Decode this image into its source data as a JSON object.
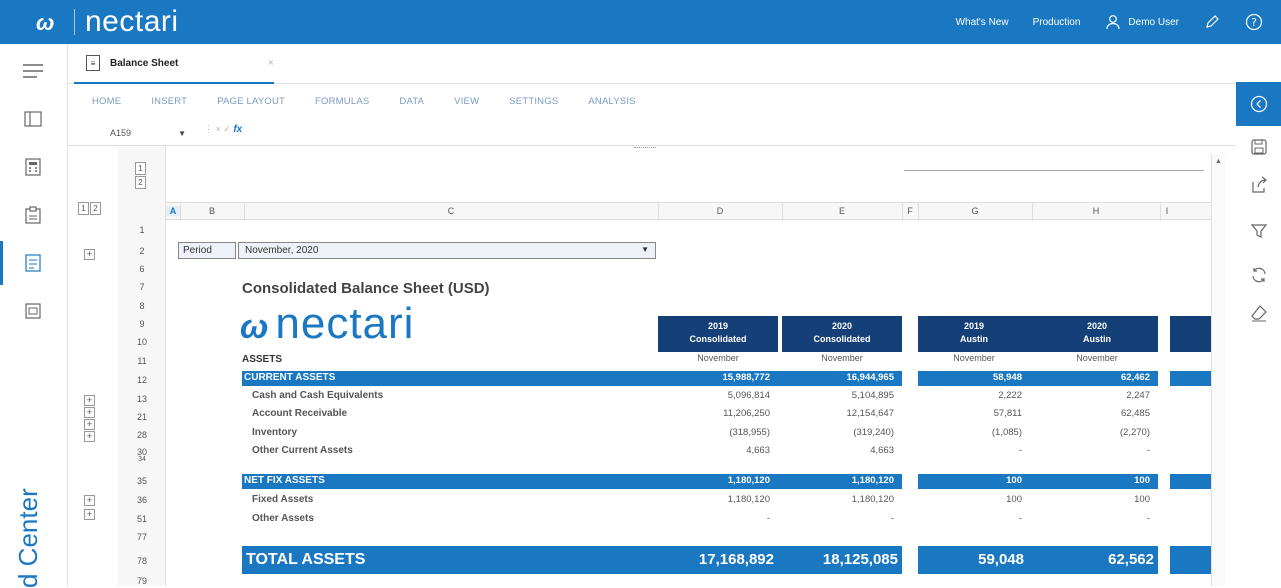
{
  "header": {
    "brand_mark": "ω",
    "brand_name": "nectari",
    "whats_new": "What's New",
    "environment": "Production",
    "user": "Demo User",
    "user_icon": "user-icon",
    "edit_icon": "pencil-icon",
    "help_icon": "help-icon",
    "bg_color": "#1a78c2"
  },
  "left_rail": {
    "items": [
      "panel-icon",
      "calculator-icon",
      "clipboard-icon",
      "document-icon",
      "folder-icon"
    ],
    "vertical_label": "d Center"
  },
  "right_rail": {
    "items": [
      "collapse-icon",
      "save-icon",
      "share-icon",
      "filter-icon",
      "refresh-icon",
      "eraser-icon"
    ]
  },
  "tab": {
    "title": "Balance Sheet",
    "close": "×"
  },
  "ribbon": {
    "items": [
      "HOME",
      "INSERT",
      "PAGE LAYOUT",
      "FORMULAS",
      "DATA",
      "VIEW",
      "SETTINGS",
      "ANALYSIS"
    ]
  },
  "formula_bar": {
    "cell_ref": "A159",
    "fx": "fx",
    "separators": "⋮  ×  ✓"
  },
  "outline": {
    "levels_top": [
      "1",
      "2"
    ],
    "levels_left": [
      "1",
      "2"
    ],
    "plus": "+"
  },
  "columns": [
    "A",
    "B",
    "C",
    "D",
    "E",
    "F",
    "G",
    "H",
    "I"
  ],
  "rows": [
    "1",
    "2",
    "6",
    "7",
    "8",
    "9",
    "10",
    "11",
    "12",
    "13",
    "21",
    "28",
    "30",
    "34",
    "35",
    "36",
    "51",
    "77",
    "78",
    "79"
  ],
  "sheet": {
    "period_label": "Period",
    "period_value": "November, 2020",
    "title": "Consolidated Balance Sheet (USD)",
    "logo_mark": "ω",
    "logo_text": "nectari",
    "assets_label": "ASSETS",
    "col_heads": [
      {
        "year": "2019",
        "entity": "Consolidated",
        "month": "November"
      },
      {
        "year": "2020",
        "entity": "Consolidated",
        "month": "November"
      },
      {
        "year": "2019",
        "entity": "Austin",
        "month": "November"
      },
      {
        "year": "2020",
        "entity": "Austin",
        "month": "November"
      }
    ],
    "current_assets": {
      "label": "CURRENT ASSETS",
      "values": [
        "15,988,772",
        "16,944,965",
        "58,948",
        "62,462"
      ]
    },
    "current_rows": [
      {
        "label": "Cash and Cash Equivalents",
        "values": [
          "5,096,814",
          "5,104,895",
          "2,222",
          "2,247"
        ]
      },
      {
        "label": "Account Receivable",
        "values": [
          "11,206,250",
          "12,154,647",
          "57,811",
          "62,485"
        ]
      },
      {
        "label": "Inventory",
        "values": [
          "(318,955)",
          "(319,240)",
          "(1,085)",
          "(2,270)"
        ]
      },
      {
        "label": "Other Current Assets",
        "values": [
          "4,663",
          "4,663",
          "-",
          "-"
        ]
      }
    ],
    "net_fix_assets": {
      "label": "NET FIX ASSETS",
      "values": [
        "1,180,120",
        "1,180,120",
        "100",
        "100"
      ]
    },
    "fix_rows": [
      {
        "label": "Fixed Assets",
        "values": [
          "1,180,120",
          "1,180,120",
          "100",
          "100"
        ]
      },
      {
        "label": "Other Assets",
        "values": [
          "-",
          "-",
          "-",
          "-"
        ]
      }
    ],
    "total_assets": {
      "label": "TOTAL ASSETS",
      "values": [
        "17,168,892",
        "18,125,085",
        "59,048",
        "62,562"
      ]
    },
    "band_color": "#1a78c2",
    "head_color": "#153f77"
  }
}
